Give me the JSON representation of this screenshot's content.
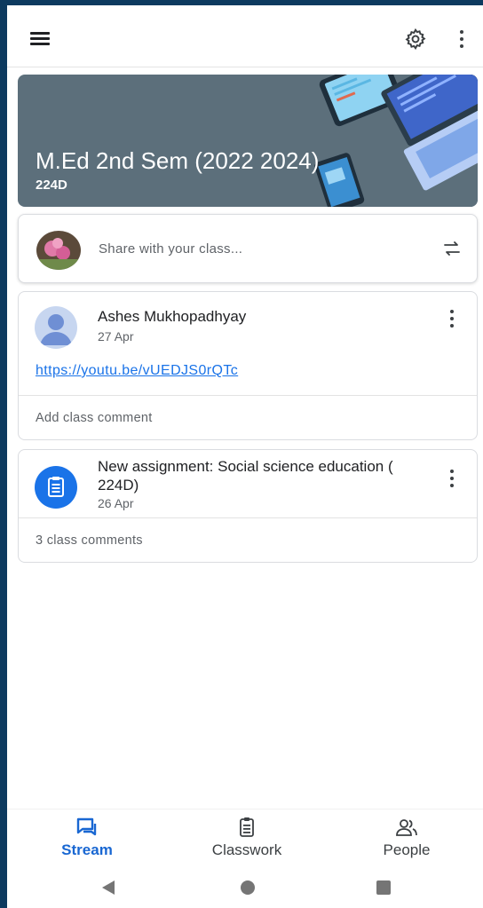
{
  "header": {
    "menu_icon": "hamburger-menu-icon",
    "settings_icon": "gear-icon",
    "overflow_icon": "more-vert-icon"
  },
  "banner": {
    "title": "M.Ed 2nd Sem (2022 2024)",
    "section": "224D",
    "background_color": "#5c6f7b"
  },
  "share": {
    "placeholder": "Share with your class...",
    "repost_icon": "repost-icon"
  },
  "posts": [
    {
      "author": "Ashes Mukhopadhyay",
      "date": "27 Apr",
      "link": "https://youtu.be/vUEDJS0rQTc",
      "comment_prompt": "Add class comment"
    }
  ],
  "assignments": [
    {
      "title": "New assignment: Social science education ( 224D)",
      "date": "26 Apr",
      "comments": "3 class comments",
      "icon": "assignment-icon"
    }
  ],
  "bottom_nav": {
    "stream": "Stream",
    "classwork": "Classwork",
    "people": "People",
    "active": "Stream",
    "active_color": "#1967d2"
  }
}
